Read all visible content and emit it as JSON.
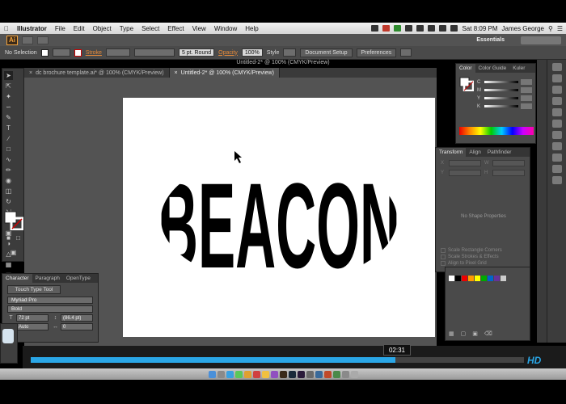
{
  "menubar": {
    "app_name": "Illustrator",
    "items": [
      "File",
      "Edit",
      "Object",
      "Type",
      "Select",
      "Effect",
      "View",
      "Window",
      "Help"
    ],
    "clock": "Sat 8:09 PM",
    "user": "James George"
  },
  "appbar": {
    "logo": "Ai",
    "workspace": "Essentials"
  },
  "controlbar": {
    "selection": "No Selection",
    "stroke_label": "Stroke",
    "brush": "5 pt. Round",
    "opacity_label": "Opacity",
    "opacity_value": "100%",
    "style_label": "Style",
    "document_setup": "Document Setup",
    "preferences": "Preferences"
  },
  "window_title": "Untitled-2* @ 100% (CMYK/Preview)",
  "tabs": [
    {
      "label": "dc brochure template.ai* @ 100% (CMYK/Preview)",
      "active": false
    },
    {
      "label": "Untitled-2* @ 100% (CMYK/Preview)",
      "active": true
    }
  ],
  "artwork": {
    "text": "BEACON",
    "effect": "envelope-warp-ellipse"
  },
  "character_panel": {
    "tabs": [
      "Character",
      "Paragraph",
      "OpenType"
    ],
    "touch_type": "Touch Type Tool",
    "font": "Myriad Pro",
    "style": "Bold",
    "size": "72 pt",
    "leading": "(86.4 pt)",
    "kerning": "Auto",
    "tracking": "0"
  },
  "color_panel": {
    "tabs": [
      "Color",
      "Color Guide",
      "Kuler"
    ],
    "channels": [
      "C",
      "M",
      "Y",
      "K"
    ]
  },
  "transform_panel": {
    "tabs": [
      "Transform",
      "Align",
      "Pathfinder"
    ],
    "fields": [
      "X",
      "W",
      "Y",
      "H"
    ],
    "message": "No Shape Properties",
    "options": [
      "Scale Rectangle Corners",
      "Scale Strokes & Effects",
      "Align to Pixel Grid"
    ]
  },
  "video": {
    "timestamp": "02:31",
    "progress_fraction": 0.74,
    "logo": "HD"
  },
  "colors": {
    "accent_blue": "#2aa6e6",
    "panel_bg": "#4a4a4a",
    "workspace_bg": "#535353"
  }
}
